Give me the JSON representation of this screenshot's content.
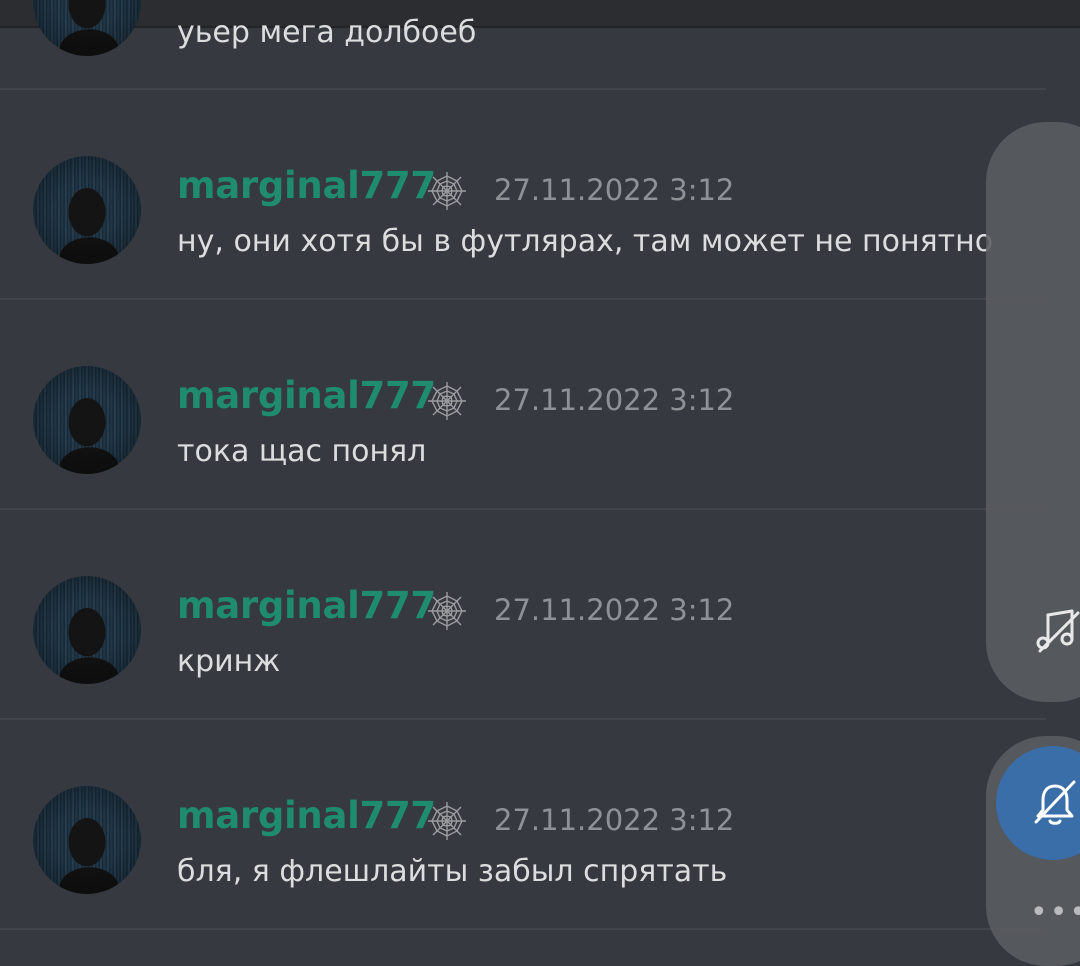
{
  "previous_message": {
    "content": "уьер мега долбоеб"
  },
  "messages": [
    {
      "username": "marginal777",
      "timestamp": "27.11.2022 3:12",
      "content": "ну, они хотя бы в футлярах, там может не понятно"
    },
    {
      "username": "marginal777",
      "timestamp": "27.11.2022 3:12",
      "content": "тока щас понял"
    },
    {
      "username": "marginal777",
      "timestamp": "27.11.2022 3:12",
      "content": "кринж"
    },
    {
      "username": "marginal777",
      "timestamp": "27.11.2022 3:12",
      "content": "бля, я флешлайты забыл спрятать"
    }
  ],
  "icons": {
    "badge": "spiderweb-icon",
    "side_panel": "music-note-icon",
    "bell": "bell-off-icon",
    "more": "more-dots-icon"
  },
  "colors": {
    "background": "#36393f",
    "username": "#1f8b6f",
    "timestamp": "#8e9297",
    "message_text": "#dcddde",
    "bell_button": "#3a6ea8"
  }
}
